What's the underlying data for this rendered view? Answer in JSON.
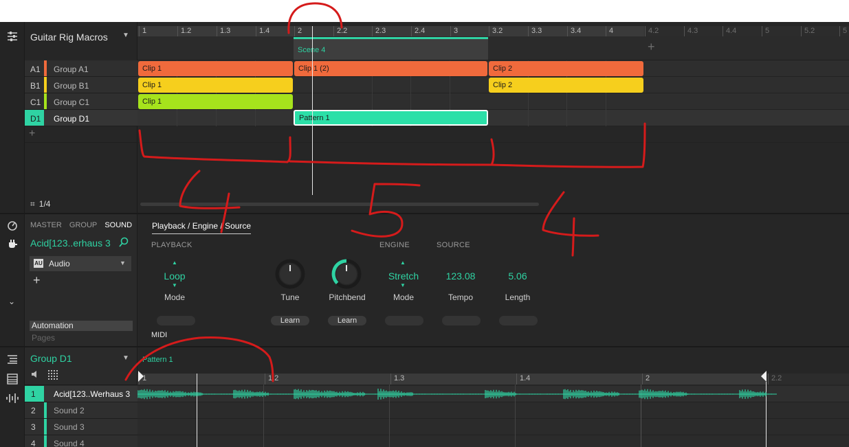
{
  "header": {
    "title": "Guitar Rig Macros"
  },
  "ruler": {
    "active": [
      "1",
      "1.2",
      "1.3",
      "1.4",
      "2",
      "2.2",
      "2.3",
      "2.4",
      "3",
      "3.2",
      "3.3",
      "3.4",
      "4"
    ],
    "inactive": [
      "4.2",
      "4.3",
      "4.4",
      "5",
      "5.2",
      "5"
    ]
  },
  "scene": {
    "label": "Scene 4"
  },
  "groups": [
    {
      "letter": "A1",
      "name": "Group A1",
      "color": "#f06a3c"
    },
    {
      "letter": "B1",
      "name": "Group B1",
      "color": "#f6cf1d"
    },
    {
      "letter": "C1",
      "name": "Group C1",
      "color": "#a6e31c"
    },
    {
      "letter": "D1",
      "name": "Group D1",
      "color": "#2fd3a3"
    }
  ],
  "clips": {
    "a1_1": "Clip 1",
    "a1_2": "Clip 1 (2)",
    "a1_3": "Clip 2",
    "b1_1": "Clip 1",
    "b1_3": "Clip 2",
    "c1_1": "Clip 1",
    "d1_1": "Pattern 1"
  },
  "group_page": "1/4",
  "plugin_panel": {
    "tabs": [
      "MASTER",
      "GROUP",
      "SOUND"
    ],
    "sound_name": "Acid[123..erhaus 3",
    "plugin_badge": "AU",
    "plugin": "Audio",
    "automation": "Automation",
    "pages": "Pages"
  },
  "page_tab": "Playback / Engine / Source",
  "sections": {
    "playback": "PLAYBACK",
    "engine": "ENGINE",
    "source": "SOURCE",
    "midi": "MIDI"
  },
  "controls": {
    "loop": {
      "value": "Loop",
      "label": "Mode"
    },
    "tune": {
      "label": "Tune",
      "learn": "Learn"
    },
    "pitchbend": {
      "label": "Pitchbend",
      "learn": "Learn"
    },
    "stretch": {
      "value": "Stretch",
      "label": "Mode"
    },
    "tempo": {
      "value": "123.08",
      "label": "Tempo"
    },
    "length": {
      "value": "5.06",
      "label": "Length"
    }
  },
  "pattern_panel": {
    "group": "Group D1",
    "pattern": "Pattern 1",
    "ruler": [
      "1",
      "1.2",
      "1.3",
      "1.4",
      "2",
      "2.2"
    ],
    "sounds": [
      {
        "num": "1",
        "name": "Acid[123..Werhaus 3"
      },
      {
        "num": "2",
        "name": "Sound 2"
      },
      {
        "num": "3",
        "name": "Sound 3"
      },
      {
        "num": "4",
        "name": "Sound 4"
      }
    ]
  },
  "annotations": [
    "4",
    "5",
    "4"
  ],
  "colors": {
    "accent": "#2fd3a3",
    "orange": "#f06a3c",
    "yellow": "#f6cf1d",
    "green": "#a6e31c",
    "annotation": "#d51b1b"
  }
}
